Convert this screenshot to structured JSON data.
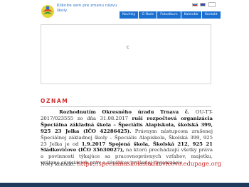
{
  "header": {
    "site_title": "Kliknite sem pre zmenu názvu školy"
  },
  "nav": {
    "items": [
      "Novinky",
      "O škole",
      "Fotoalbum",
      "Kalendár",
      "Kontakt"
    ]
  },
  "banner": {
    "mark": "c"
  },
  "notice": {
    "title": "OZNAM",
    "p1": "Rozhodnutím Okresného úradu Trnava č.",
    "p2": "OU-TT-2017/023555 zo",
    "p3": "dňa 31.08.2017",
    "p4": "ruší rozpočtová organizácia Špeciálna základná škola – Špeciális Alapiskola, školská 399, 925 23 Jelka (IČO 42286425).",
    "p5": "Právnym nástupcom zrušenej Špeciálnej základnej školy – Špeciális Alapiskola, Školská 399, 925 23 Jelka je od",
    "p6": "1.9.2017",
    "p7": "Spojená škola, Školská 212, 925 21 Sládkovičovo (IČO 35630027),",
    "p8": "na ktorú prechádzajú všetky práva a povinnosti týkajúce sa pracovnoprávnych vzťahov, majetku, vrátane súvisiacich práv a záväzkov zrušenej organizácie"
  },
  "contact": {
    "label": "Nový kontakt:",
    "link": "https://specialnaskolasladkovicovo.edupage.org"
  },
  "colors": {
    "nav_bg": "#1b6fd0",
    "accent_red": "#d12d2d",
    "footer_bg": "#1f3b5c"
  }
}
